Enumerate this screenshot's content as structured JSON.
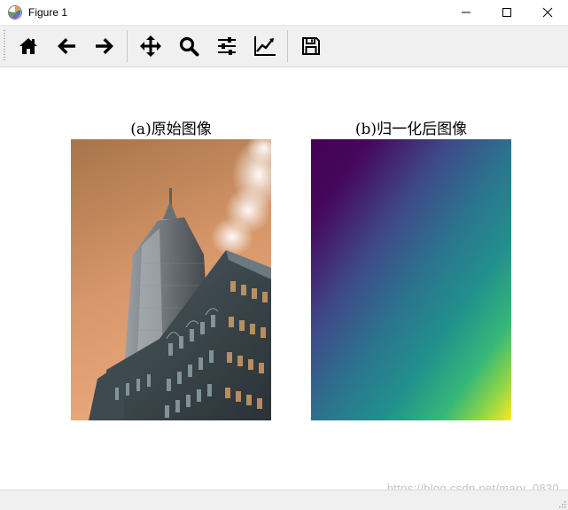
{
  "window": {
    "title": "Figure 1",
    "controls": [
      "minimize",
      "maximize",
      "close"
    ]
  },
  "toolbar": {
    "buttons": [
      {
        "name": "home",
        "icon": "home-icon"
      },
      {
        "name": "back",
        "icon": "arrow-left-icon"
      },
      {
        "name": "forward",
        "icon": "arrow-right-icon"
      },
      {
        "name": "pan",
        "icon": "move-icon"
      },
      {
        "name": "zoom",
        "icon": "magnifier-icon"
      },
      {
        "name": "subplots",
        "icon": "sliders-icon"
      },
      {
        "name": "edit-axis",
        "icon": "line-chart-icon"
      },
      {
        "name": "save",
        "icon": "floppy-disk-icon"
      }
    ]
  },
  "figure": {
    "panel_a_title": "(a)原始图像",
    "panel_b_title": "(b)归一化后图像",
    "colors": {
      "sky_top": "#b07a4a",
      "sky_bottom": "#e8a878",
      "viridis": [
        "#440154",
        "#3b528b",
        "#21918c",
        "#5ec962",
        "#fde725"
      ]
    }
  },
  "watermark": "https://blog.csdn.net/mary_0830"
}
